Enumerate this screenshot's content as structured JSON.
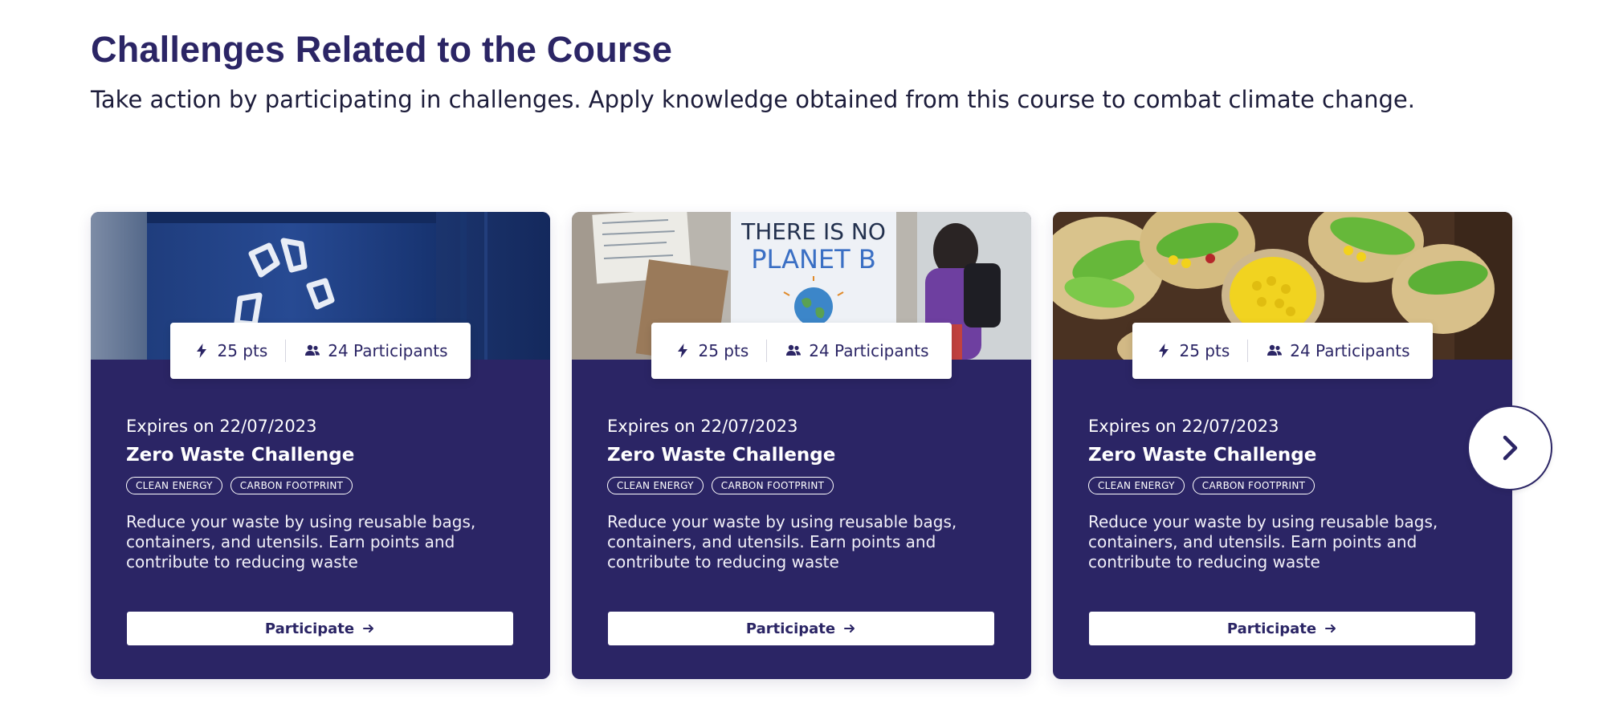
{
  "section": {
    "title": "Challenges Related to the Course",
    "subtitle": "Take action by participating in challenges. Apply knowledge obtained from this course to combat climate change."
  },
  "colors": {
    "primary": "#2b2565",
    "card_background": "#2b2565",
    "text_on_card": "#ffffff",
    "page_background": "#ffffff"
  },
  "cards": [
    {
      "image": "recycling-bin-photo",
      "points": "25 pts",
      "participants": "24 Participants",
      "expires": "Expires on 22/07/2023",
      "title": "Zero Waste Challenge",
      "tags": [
        "CLEAN ENERGY",
        "CARBON FOOTPRINT"
      ],
      "description": "Reduce your waste by using reusable bags, containers, and utensils. Earn points and contribute to reducing waste",
      "button": "Participate"
    },
    {
      "image": "climate-protest-photo",
      "image_sign_text": "THERE IS NO PLANET B",
      "points": "25 pts",
      "participants": "24 Participants",
      "expires": "Expires on 22/07/2023",
      "title": "Zero Waste Challenge",
      "tags": [
        "CLEAN ENERGY",
        "CARBON FOOTPRINT"
      ],
      "description": "Reduce your waste by using reusable bags, containers, and utensils. Earn points and contribute to reducing waste",
      "button": "Participate"
    },
    {
      "image": "avocado-tacos-photo",
      "points": "25 pts",
      "participants": "24 Participants",
      "expires": "Expires on 22/07/2023",
      "title": "Zero Waste Challenge",
      "tags": [
        "CLEAN ENERGY",
        "CARBON FOOTPRINT"
      ],
      "description": "Reduce your waste by using reusable bags, containers, and utensils. Earn points and contribute to reducing waste",
      "button": "Participate"
    }
  ],
  "icons": {
    "points": "lightning-bolt-icon",
    "participants": "people-icon",
    "button_arrow": "arrow-right-icon",
    "carousel_next": "chevron-right-icon"
  }
}
